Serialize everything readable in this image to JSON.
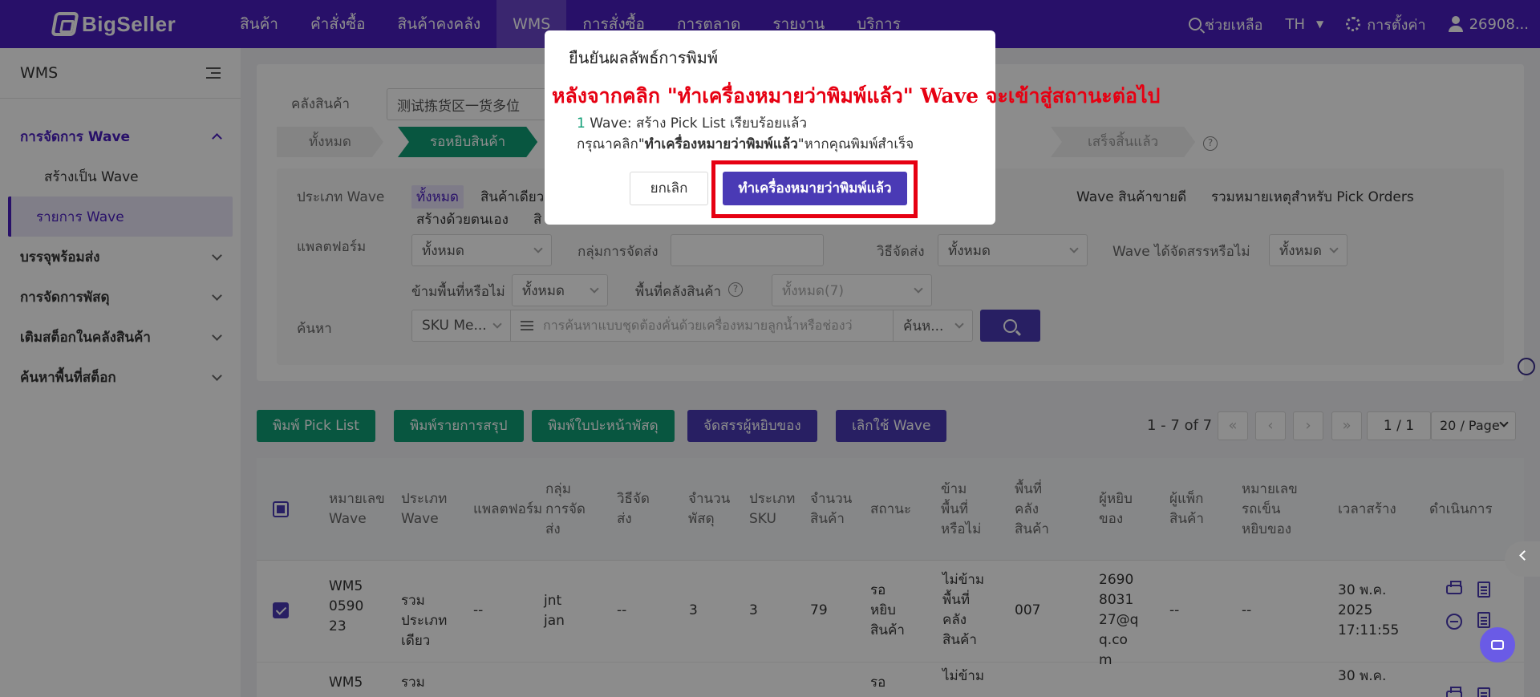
{
  "brand": "BigSeller",
  "nav": {
    "menu": [
      "สินค้า",
      "คำสั่งซื้อ",
      "สินค้าคงคลัง",
      "WMS",
      "การสั่งซื้อ",
      "การตลาด",
      "รายงาน",
      "บริการ"
    ],
    "help": "ช่วยเหลือ",
    "lang": "TH",
    "settings": "การตั้งค่า",
    "user": "26908..."
  },
  "sidebar": {
    "title": "WMS",
    "group_wave": "การจัดการ Wave",
    "sub_create": "สร้างเป็น Wave",
    "sub_list": "รายการ Wave",
    "group_pack": "บรรจุพร้อมส่ง",
    "group_parcel": "การจัดการพัสดุ",
    "group_restock": "เติมสต็อกในคลังสินค้า",
    "group_location": "ค้นหาพื้นที่สต็อก"
  },
  "filters": {
    "warehouse_label": "คลังสินค้า",
    "warehouse_value": "测试拣货区一货多位",
    "tabs": [
      "ทั้งหมด",
      "รอหยิบสินค้า",
      "เสร็จสิ้นแล้ว"
    ],
    "type_label": "ประเภท Wave",
    "type_all": "ทั้งหมด",
    "type_single": "สินค้าเดียว",
    "type_hot": "Wave สินค้าขายดี",
    "type_combined": "รวมหมายเหตุสำหรับ Pick Orders",
    "type_manual": "สร้างด้วยตนเอง",
    "type_partial": "สิ",
    "platform_label": "แพลตฟอร์ม",
    "platform_value": "ทั้งหมด",
    "group_label": "กลุ่มการจัดส่ง",
    "method_label": "วิธีจัดส่ง",
    "method_value": "ทั้งหมด",
    "assigned_label": "Wave ได้จัดสรรหรือไม่",
    "assigned_value": "ทั้งหมด",
    "cross_label": "ข้ามพื้นที่หรือไม่",
    "cross_value": "ทั้งหมด",
    "area_label": "พื้นที่คลังสินค้า",
    "area_value": "ทั้งหมด(7)",
    "search_label": "ค้นหา",
    "search_field": "SKU Me...",
    "search_placeholder": "การค้นหาแบบชุดต้องคั่นด้วยเครื่องหมายลูกน้ำหรือช่องว่",
    "search_mode": "ค้นห..."
  },
  "actions": {
    "print_pick": "พิมพ์ Pick List",
    "print_summary": "พิมพ์รายการสรุป",
    "print_label": "พิมพ์ใบปะหน้าพัสดุ",
    "assign_picker": "จัดสรรผู้หยิบของ",
    "cancel_wave": "เลิกใช้ Wave"
  },
  "pagination": {
    "range": "1 - 7 of 7",
    "page": "1 / 1",
    "page_size": "20 / Page"
  },
  "table": {
    "headers": {
      "wave_no": "หมายเลข Wave",
      "wave_type": "ประเภท Wave",
      "platform": "แพลตฟอร์ม",
      "ship_group": "กลุ่มการจัดส่ง",
      "ship_method": "วิธีจัดส่ง",
      "parcels": "จำนวนพัสดุ",
      "sku_types": "ประเภท SKU",
      "qty": "จำนวนสินค้า",
      "status": "สถานะ",
      "cross_area": "ข้ามพื้นที่หรือไม่",
      "area": "พื้นที่คลังสินค้า",
      "picker": "ผู้หยิบของ",
      "packer": "ผู้แพ็กสินค้า",
      "picking_basket": "หมายเลขรถเข็นหยิบของ",
      "created": "เวลาสร้าง",
      "ops": "ดำเนินการ"
    },
    "rows": [
      {
        "wave_no": "WM5059023",
        "wave_type": "รวมประเภทเดียว",
        "platform": "--",
        "ship_group": "jnt jan",
        "ship_method": "--",
        "parcels": "3",
        "sku_types": "3",
        "qty": "79",
        "status": "รอหยิบสินค้า",
        "cross_area": "ไม่ข้ามพื้นที่คลังสินค้า",
        "area": "007",
        "picker": "26908031 27@qq.com",
        "packer": "--",
        "picking_basket": "--",
        "created": "30 พ.ค. 2025 17:11:55"
      },
      {
        "wave_no": "WM5",
        "wave_type": "รวม",
        "status": "รอ",
        "cross_area": "ไม่ข้าม",
        "created": "30 พ.ค."
      }
    ]
  },
  "modal": {
    "title": "ยืนยันผลลัพธ์การพิมพ์",
    "annotation": "หลังจากคลิก \"ทำเครื่องหมายว่าพิมพ์แล้ว\" Wave จะเข้าสู่สถานะต่อไป",
    "count": "1",
    "line1": " Wave: สร้าง Pick List เรียบร้อยแล้ว",
    "line2_pre": "กรุณาคลิก\"",
    "line2_bold": "ทำเครื่องหมายว่าพิมพ์แล้ว",
    "line2_post": "\"หากคุณพิมพ์สำเร็จ",
    "cancel": "ยกเลิก",
    "confirm": "ทำเครื่องหมายว่าพิมพ์แล้ว"
  }
}
